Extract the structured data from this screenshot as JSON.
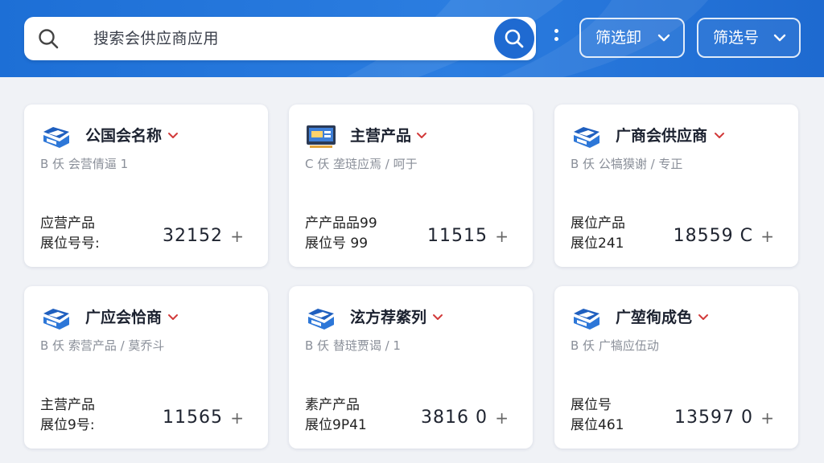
{
  "search": {
    "placeholder": "搜索会供应商应用",
    "icon": "search-icon",
    "button_icon": "search-icon"
  },
  "more_icon": "more-vertical-icon",
  "filters": [
    {
      "label": "筛选卸",
      "icon": "chevron-down-icon"
    },
    {
      "label": "筛选号",
      "icon": "chevron-down-icon"
    }
  ],
  "colors": {
    "header": "#1f6ad1",
    "accent": "#1f6ad1",
    "caret": "#d23a3a"
  },
  "cards": [
    {
      "icon": "supplier-logo-icon",
      "name": "公国会名称",
      "sub": "B  仸 会营倩逼 1",
      "line1": "应营产品",
      "line2": "展位号号:",
      "number": "32152",
      "plus": "+"
    },
    {
      "icon": "monitor-icon",
      "name": "主营产品",
      "sub": "C  仸 垄琏应焉 / 呵于",
      "line1": "产产品品99",
      "line2": "展位号 99",
      "number": "11515",
      "plus": "+"
    },
    {
      "icon": "supplier-logo-icon",
      "name": "广商会供应商",
      "sub": "B  仸 公犒獏谢 / 专正",
      "line1": "展位产品",
      "line2": "展位241",
      "number": "18559 C",
      "plus": "+"
    },
    {
      "icon": "supplier-logo-icon",
      "name": "广应会恰商",
      "sub": "B  仸 索营产品 / 莫乔斗",
      "line1": "主营产品",
      "line2": "展位9号:",
      "number": "11565",
      "plus": "+"
    },
    {
      "icon": "supplier-logo-icon",
      "name": "泫方荐綮列",
      "sub": "B  仸 替琏贾谒 / 1",
      "line1": "素产产品",
      "line2": "展位9P41",
      "number": "3816 0",
      "plus": "+"
    },
    {
      "icon": "supplier-logo-icon",
      "name": "广堃徇成色",
      "sub": "B  仸 广犒应伍动",
      "line1": "展位号",
      "line2": "展位461",
      "number": "13597 0",
      "plus": "+"
    }
  ]
}
